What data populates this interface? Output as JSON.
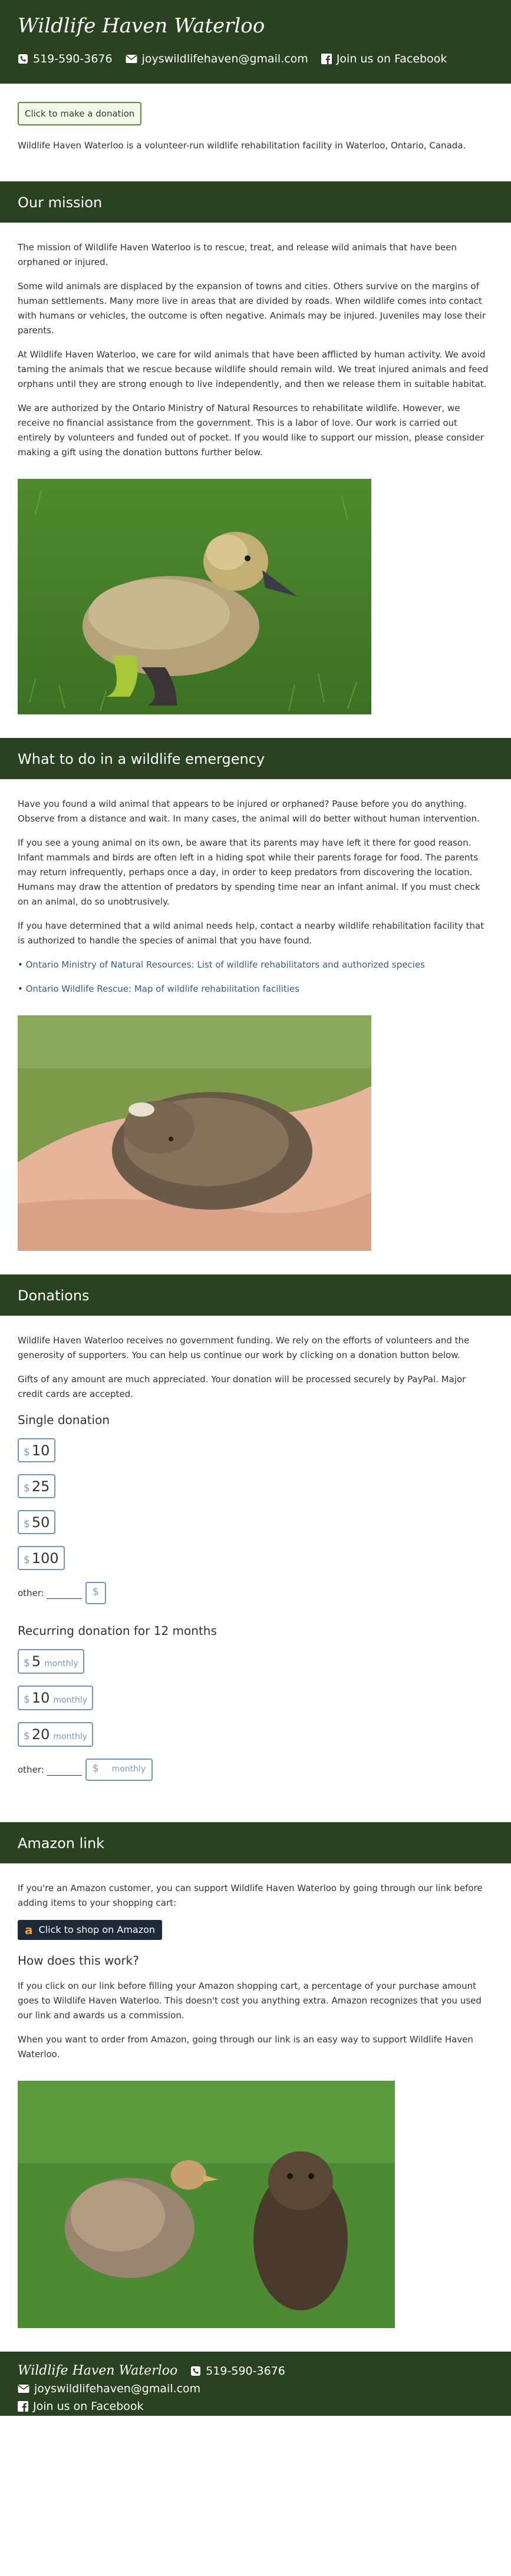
{
  "site": {
    "title": "Wildlife Haven Waterloo",
    "phone": "519-590-3676",
    "email": "joyswildlifehaven@gmail.com",
    "facebook": "Join us on Facebook"
  },
  "top_donate_label": "Click to make a donation",
  "intro": "Wildlife Haven Waterloo is a volunteer-run wildlife rehabilitation facility in Waterloo, Ontario, Canada.",
  "mission": {
    "heading": "Our mission",
    "paragraphs": [
      "The mission of Wildlife Haven Waterloo is to rescue, treat, and release wild animals that have been orphaned or injured.",
      "Some wild animals are displaced by the expansion of towns and cities. Others survive on the margins of human settlements. Many more live in areas that are divided by roads. When wildlife comes into contact with humans or vehicles, the outcome is often negative. Animals may be injured. Juveniles may lose their parents.",
      "At Wildlife Haven Waterloo, we care for wild animals that have been afflicted by human activity. We avoid taming the animals that we rescue because wildlife should remain wild. We treat injured animals and feed orphans until they are strong enough to live independently, and then we release them in suitable habitat.",
      "We are authorized by the Ontario Ministry of Natural Resources to rehabilitate wildlife. However, we receive no financial assistance from the government. This is a labor of love. Our work is carried out entirely by volunteers and funded out of pocket. If you would like to support our mission, please consider making a gift using the donation buttons further below."
    ]
  },
  "emergency": {
    "heading": "What to do in a wildlife emergency",
    "paragraphs": [
      "Have you found a wild animal that appears to be injured or orphaned? Pause before you do anything. Observe from a distance and wait. In many cases, the animal will do better without human intervention.",
      "If you see a young animal on its own, be aware that its parents may have left it there for good reason. Infant mammals and birds are often left in a hiding spot while their parents forage for food. The parents may return infrequently, perhaps once a day, in order to keep predators from discovering the location. Humans may draw the attention of predators by spending time near an infant animal. If you must check on an animal, do so unobtrusively.",
      "If you have determined that a wild animal needs help, contact a nearby wildlife rehabilitation facility that is authorized to handle the species of animal that you have found."
    ],
    "links": [
      "Ontario Ministry of Natural Resources: List of wildlife rehabilitators and authorized species",
      "Ontario Wildlife Rescue: Map of wildlife rehabilitation facilities"
    ]
  },
  "donations": {
    "heading": "Donations",
    "paragraphs": [
      "Wildlife Haven Waterloo receives no government funding. We rely on the efforts of volunteers and the generosity of supporters. You can help us continue our work by clicking on a donation button below.",
      "Gifts of any amount are much appreciated. Your donation will be processed securely by PayPal. Major credit cards are accepted."
    ],
    "single_heading": "Single donation",
    "single_amounts": [
      "10",
      "25",
      "50",
      "100"
    ],
    "currency": "$",
    "other_label": "other:",
    "recurring_heading": "Recurring donation for 12 months",
    "recurring_amounts": [
      "5",
      "10",
      "20"
    ],
    "monthly_label": "monthly"
  },
  "amazon": {
    "heading": "Amazon link",
    "intro": "If you're an Amazon customer, you can support Wildlife Haven Waterloo by going through our link before adding items to your shopping cart:",
    "button_label": "Click to shop on Amazon",
    "how_heading": "How does this work?",
    "paragraphs": [
      "If you click on our link before filling your Amazon shopping cart, a percentage of your purchase amount goes to Wildlife Haven Waterloo. This doesn't cost you anything extra. Amazon recognizes that you used our link and awards us a commission.",
      "When you want to order from Amazon, going through our link is an easy way to support Wildlife Haven Waterloo."
    ]
  },
  "colors": {
    "band": "#2b4222",
    "link": "#3a5a8c",
    "button_border": "#6e94c0"
  },
  "icons": {
    "phone": "phone-icon",
    "email": "envelope-icon",
    "facebook": "facebook-icon",
    "amazon": "amazon-icon"
  }
}
